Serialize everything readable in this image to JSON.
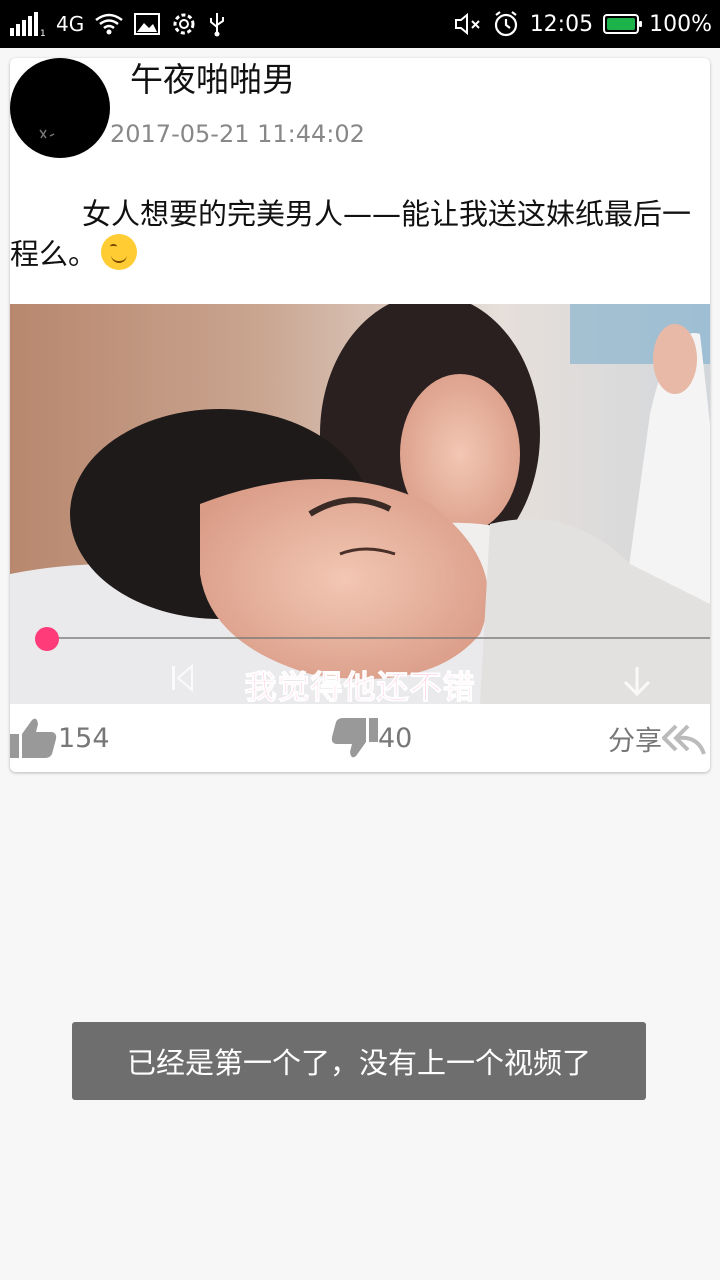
{
  "status_bar": {
    "network": "4G",
    "time": "12:05",
    "battery": "100%",
    "battery_level": 1.0,
    "icons": [
      "signal-icon",
      "wifi-icon",
      "image-icon",
      "gear-icon",
      "usb-icon",
      "mute-icon",
      "alarm-icon",
      "battery-icon"
    ]
  },
  "post": {
    "author": "午夜啪啪男",
    "timestamp": "2017-05-21 11:44:02",
    "text": "女人想要的完美男人——能让我送这妹纸最后一程么。",
    "emoji": "smirk-emoji"
  },
  "video": {
    "subtitle": "我觉得他还不错",
    "progress": 0.0,
    "accent_color": "#ff3b7a"
  },
  "actions": {
    "likes": "154",
    "dislikes": "40",
    "share_label": "分享"
  },
  "toast": {
    "message": "已经是第一个了，没有上一个视频了"
  }
}
